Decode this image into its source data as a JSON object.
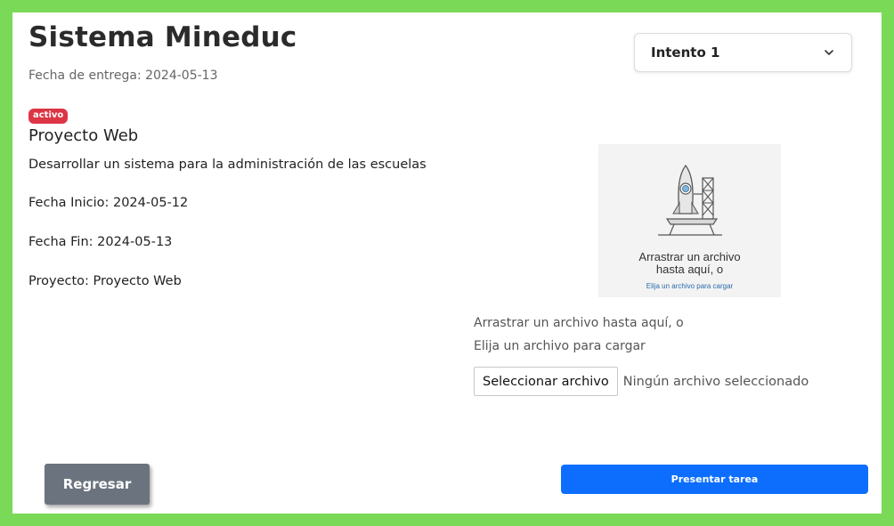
{
  "header": {
    "title": "Sistema Mineduc",
    "due_date": "Fecha de entrega: 2024-05-13",
    "attempt_selected": "Intento 1"
  },
  "task": {
    "status_badge": "activo",
    "name": "Proyecto Web",
    "description": "Desarrollar un sistema para la administración de las escuelas",
    "start_date": "Fecha Inicio: 2024-05-12",
    "end_date": "Fecha Fin: 2024-05-13",
    "project": "Proyecto: Proyecto Web"
  },
  "dropzone": {
    "line1": "Arrastrar un archivo",
    "line2": "hasta aquí, o",
    "link": "Elija un archivo para cargar"
  },
  "upload": {
    "hint1": "Arrastrar un archivo hasta aquí, o",
    "hint2": "Elija un archivo para cargar",
    "choose_label": "Seleccionar archivo",
    "no_file": "Ningún archivo seleccionado"
  },
  "actions": {
    "back": "Regresar",
    "submit": "Presentar tarea"
  },
  "colors": {
    "frame_border": "#7ad957",
    "badge": "#dc3545",
    "primary": "#0d6efd",
    "secondary": "#6b747e"
  },
  "icons": {
    "attempt_chevron": "chevron-down-icon",
    "dropzone_art": "rocket-launch-icon"
  }
}
